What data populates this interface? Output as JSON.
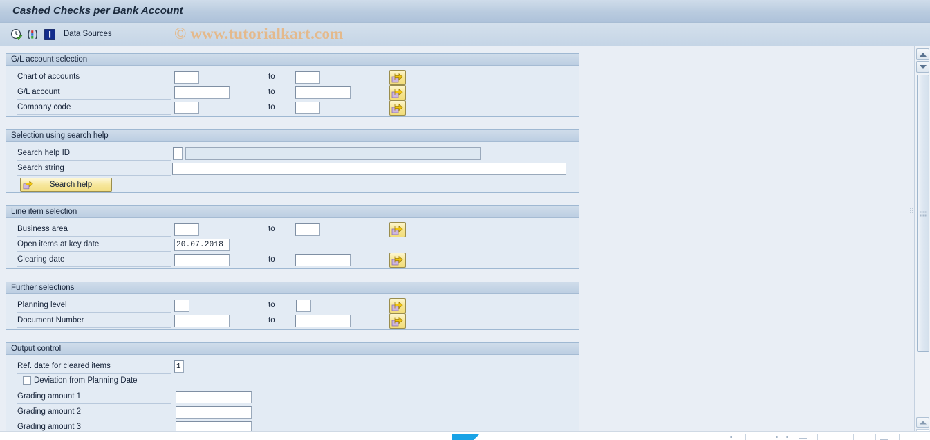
{
  "window": {
    "title": "Cashed Checks per Bank Account",
    "watermark": "© www.tutorialkart.com"
  },
  "toolbar": {
    "icons": [
      {
        "name": "execute-clock-icon",
        "label": "Execute"
      },
      {
        "name": "variant-icon",
        "label": "Get Variant"
      },
      {
        "name": "info-icon",
        "label": "Information"
      }
    ],
    "data_sources_label": "Data Sources"
  },
  "sections": [
    {
      "id": "gl-account-selection",
      "title": "G/L account selection",
      "rows": [
        {
          "label": "Chart of accounts",
          "from_value": "",
          "to_label": "to",
          "to_value": "",
          "size": "xs",
          "multi_select": true
        },
        {
          "label": "G/L account",
          "from_value": "",
          "to_label": "to",
          "to_value": "",
          "size": "md",
          "multi_select": true
        },
        {
          "label": "Company code",
          "from_value": "",
          "to_label": "to",
          "to_value": "",
          "size": "xs",
          "multi_select": true
        }
      ]
    },
    {
      "id": "selection-using-search-help",
      "title": "Selection using search help",
      "rows": [
        {
          "label": "Search help ID",
          "from_value": "",
          "aux_value": "",
          "readonly_aux": true
        },
        {
          "label": "Search string",
          "from_value": ""
        }
      ],
      "button": {
        "label": "Search help"
      }
    },
    {
      "id": "line-item-selection",
      "title": "Line item selection",
      "rows": [
        {
          "label": "Business area",
          "from_value": "",
          "to_label": "to",
          "to_value": "",
          "size": "xs",
          "multi_select": true
        },
        {
          "label": "Open items at key date",
          "from_value": "20.07.2018",
          "size": "md"
        },
        {
          "label": "Clearing date",
          "from_value": "",
          "to_label": "to",
          "to_value": "",
          "size": "md",
          "multi_select": true
        }
      ]
    },
    {
      "id": "further-selections",
      "title": "Further selections",
      "rows": [
        {
          "label": "Planning level",
          "from_value": "",
          "to_label": "to",
          "to_value": "",
          "size": "xxs",
          "multi_select": true
        },
        {
          "label": "Document Number",
          "from_value": "",
          "to_label": "to",
          "to_value": "",
          "size": "md",
          "multi_select": true
        }
      ]
    },
    {
      "id": "output-control",
      "title": "Output control",
      "rows": [
        {
          "label": "Ref. date for cleared items",
          "from_value": "1",
          "size": "tiny"
        },
        {
          "label": "Deviation from Planning Date",
          "type": "checkbox",
          "checked": false
        },
        {
          "label": "Grading amount 1",
          "from_value": "",
          "size": "lg"
        },
        {
          "label": "Grading amount 2",
          "from_value": "",
          "size": "lg"
        },
        {
          "label": "Grading amount 3",
          "from_value": "",
          "size": "lg"
        }
      ]
    }
  ],
  "scrollbar": {
    "up_arrow": "scroll-up",
    "down_arrow": "scroll-down",
    "thumb": "scroll-thumb"
  },
  "colors": {
    "title_gradient_top": "#cfdcea",
    "title_gradient_bottom": "#aec2da",
    "panel_bg": "#e3ebf4",
    "panel_border": "#9fb8d2",
    "page_bg": "#e9eef5",
    "button_yellow": "#f6e594",
    "watermark": "#e6b887"
  }
}
